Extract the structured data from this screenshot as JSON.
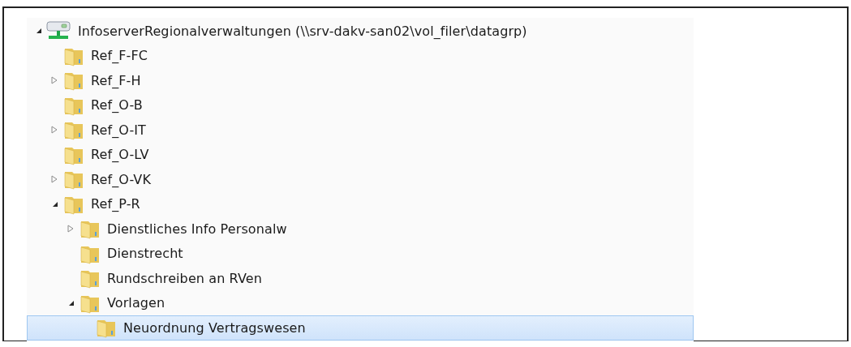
{
  "tree": {
    "label": "InfoserverRegionalverwaltungen (\\\\srv-dakv-san02\\vol_filer\\datagrp)",
    "kind": "server",
    "expanded": true,
    "selected": false,
    "children": [
      {
        "label": "Ref_F-FC",
        "kind": "folder",
        "selected": false
      },
      {
        "label": "Ref_F-H",
        "kind": "folder",
        "expanded": false,
        "selected": false
      },
      {
        "label": "Ref_O-B",
        "kind": "folder",
        "selected": false
      },
      {
        "label": "Ref_O-IT",
        "kind": "folder",
        "expanded": false,
        "selected": false
      },
      {
        "label": "Ref_O-LV",
        "kind": "folder",
        "selected": false
      },
      {
        "label": "Ref_O-VK",
        "kind": "folder",
        "expanded": false,
        "selected": false
      },
      {
        "label": "Ref_P-R",
        "kind": "folder",
        "expanded": true,
        "selected": false,
        "children": [
          {
            "label": "Dienstliches Info Personalw",
            "kind": "folder",
            "expanded": false,
            "selected": false
          },
          {
            "label": "Dienstrecht",
            "kind": "folder",
            "selected": false
          },
          {
            "label": "Rundschreiben an RVen",
            "kind": "folder",
            "selected": false
          },
          {
            "label": "Vorlagen",
            "kind": "folder",
            "expanded": true,
            "selected": false,
            "children": [
              {
                "label": "Neuordnung Vertragswesen",
                "kind": "folder",
                "selected": true
              }
            ]
          }
        ]
      }
    ]
  }
}
